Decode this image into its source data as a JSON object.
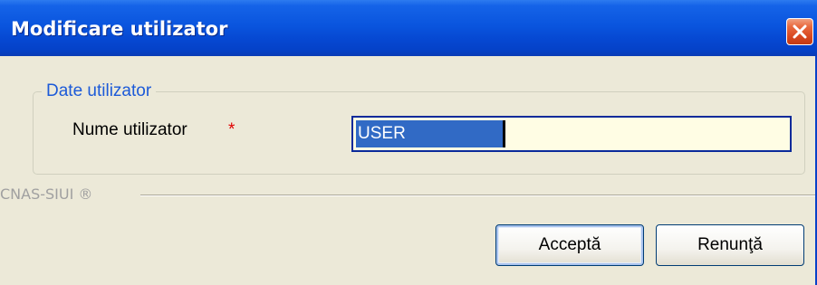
{
  "window": {
    "title": "Modificare utilizator"
  },
  "titlebar_icons": {
    "close": "close-icon"
  },
  "group": {
    "legend": "Date utilizator",
    "fields": {
      "username": {
        "label": "Nume utilizator",
        "required_marker": "*",
        "value": "USER"
      }
    }
  },
  "footer": {
    "brand": "CNAS-SIUI ®"
  },
  "buttons": {
    "accept_label": "Acceptă",
    "cancel_label": "Renunţă"
  },
  "colors": {
    "titlebar": "#0a55de",
    "window_bg": "#ece9d8",
    "legend": "#1c5ad8",
    "required": "#e00000",
    "input_bg": "#fffde4",
    "selection": "#316ac5"
  }
}
